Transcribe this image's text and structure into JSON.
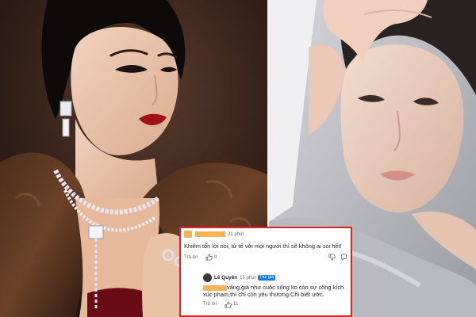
{
  "comments": {
    "comment_1": {
      "time": "21 phút",
      "text": "Khiêm tốn lời nói, tử tế với mọi người thì sẽ không ai soi hết!",
      "reply_label": "Trả lời",
      "likes": "9"
    },
    "comment_2": {
      "author": "Lê Quyên",
      "time": "15 phút",
      "author_badge": "Tác giả",
      "text": "vâng,giá như cuộc sống ko còn sự công kích xúc phạm,thì chỉ còn yêu thương.Chỉ biết ước.",
      "reply_label": "Trả lời",
      "likes": "11"
    }
  },
  "colors": {
    "frame_border": "#e02020",
    "redaction": "#f7b25a",
    "author_badge": "#1877f2"
  }
}
